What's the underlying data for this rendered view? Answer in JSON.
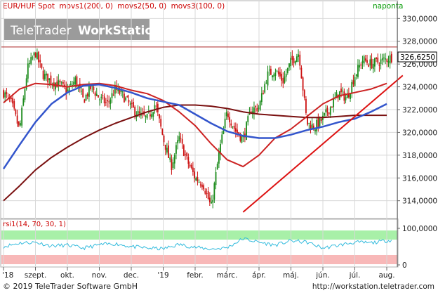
{
  "header": {
    "instrument": "EUR/HUF Spot",
    "indicator1": "movs1(200, 0)",
    "indicator2": "movs2(50, 0)",
    "indicator3": "movs3(100, 0)",
    "period": "naponta"
  },
  "watermark": {
    "brand": "TeleTrader",
    "product": "WorkStation"
  },
  "footer": {
    "copyright": "© 2019 TeleTrader Software GmbH",
    "url": "http://workstation.teletrader.com"
  },
  "colors": {
    "candle_up": "#1a8a1a",
    "candle_down": "#cc1111",
    "ma200": "#7a1010",
    "ma50": "#cc2222",
    "ma100": "#3355cc",
    "trendline": "#dd1111",
    "resistance": "#aa2222",
    "rsi_line": "#33bbdd",
    "rsi_over": "#a8f0a8",
    "rsi_under": "#f8b8b8",
    "header_text": "#cc0000",
    "period_text": "#009900"
  },
  "chart_data": [
    {
      "type": "candlestick",
      "title": "EUR/HUF Spot",
      "ylim": [
        312.5,
        331.5
      ],
      "y_ticks": [
        314,
        316,
        318,
        320,
        322,
        324,
        326,
        328,
        330
      ],
      "y_tick_labels": [
        "314,0000",
        "316,0000",
        "318,0000",
        "320,0000",
        "322,0000",
        "324,0000",
        "326,0000",
        "328,0000",
        "330,0000"
      ],
      "last_price": 326.625,
      "last_price_label": "326,6250",
      "resistance_level": 327.5,
      "x_tick_labels": [
        "'18",
        "szept.",
        "okt.",
        "nov.",
        "dec.",
        "'19",
        "febr.",
        "márc.",
        "ápr.",
        "máj.",
        "jún.",
        "júl.",
        "aug."
      ],
      "x_tick_month_index": [
        0,
        1,
        2,
        3,
        4,
        5,
        6,
        7,
        8,
        9,
        10,
        11,
        12
      ],
      "series": [
        {
          "name": "EUR/HUF Spot",
          "role": "close",
          "months": [
            0,
            0.25,
            0.5,
            0.75,
            1,
            1.25,
            1.5,
            1.75,
            2,
            2.25,
            2.5,
            2.75,
            3,
            3.25,
            3.5,
            3.75,
            4,
            4.25,
            4.5,
            4.75,
            5,
            5.25,
            5.5,
            5.75,
            6,
            6.25,
            6.5,
            6.75,
            7,
            7.25,
            7.5,
            7.75,
            8,
            8.25,
            8.5,
            8.75,
            9,
            9.25,
            9.5,
            9.75,
            10,
            10.25,
            10.5,
            10.75,
            11,
            11.25,
            11.5,
            11.75,
            12.15
          ],
          "values": [
            323.5,
            322.5,
            320.2,
            325.6,
            327.0,
            325.0,
            324.5,
            324.2,
            323.6,
            324.6,
            322.8,
            324.0,
            323.0,
            322.5,
            323.8,
            323.2,
            322.2,
            321.5,
            321.2,
            322.5,
            319.5,
            317.0,
            319.5,
            317.5,
            316.0,
            315.5,
            313.4,
            318.2,
            321.8,
            320.2,
            319.4,
            322.0,
            322.2,
            325.0,
            325.5,
            324.5,
            326.2,
            327.0,
            320.8,
            320.5,
            321.2,
            322.3,
            323.5,
            323.0,
            325.0,
            326.4,
            326.0,
            326.2,
            326.6
          ]
        },
        {
          "name": "movs1(200, 0)",
          "role": "ma",
          "months": [
            0,
            0.5,
            1,
            1.5,
            2,
            2.5,
            3,
            3.5,
            4,
            4.5,
            5,
            5.5,
            6,
            6.5,
            7,
            7.5,
            8,
            8.5,
            9,
            9.5,
            10,
            10.5,
            11,
            11.5,
            12
          ],
          "values": [
            314.0,
            315.3,
            316.7,
            317.8,
            318.7,
            319.5,
            320.2,
            320.8,
            321.3,
            321.8,
            322.2,
            322.4,
            322.4,
            322.3,
            322.1,
            321.8,
            321.6,
            321.5,
            321.4,
            321.3,
            321.3,
            321.4,
            321.5,
            321.5,
            321.5
          ]
        },
        {
          "name": "movs2(50, 0)",
          "role": "ma",
          "months": [
            0,
            0.5,
            1,
            1.5,
            2,
            2.5,
            3,
            3.5,
            4,
            4.5,
            5,
            5.5,
            6,
            6.5,
            7,
            7.5,
            8,
            8.5,
            9,
            9.5,
            10,
            10.5,
            11,
            11.5,
            12
          ],
          "values": [
            322.6,
            323.8,
            324.3,
            324.2,
            324.0,
            324.2,
            324.3,
            324.1,
            323.7,
            323.4,
            322.8,
            321.8,
            320.6,
            319.0,
            317.6,
            317.0,
            318.0,
            319.5,
            320.3,
            321.4,
            322.5,
            323.2,
            323.5,
            323.8,
            324.3
          ]
        },
        {
          "name": "movs3(100, 0)",
          "role": "ma",
          "months": [
            0,
            0.5,
            1,
            1.5,
            2,
            2.5,
            3,
            3.5,
            4,
            4.5,
            5,
            5.5,
            6,
            6.5,
            7,
            7.5,
            8,
            8.5,
            9,
            9.5,
            10,
            10.5,
            11,
            11.5,
            12
          ],
          "values": [
            316.8,
            318.9,
            320.9,
            322.5,
            323.5,
            324.1,
            324.2,
            323.9,
            323.5,
            323.0,
            322.7,
            322.4,
            321.6,
            320.8,
            320.1,
            319.7,
            319.5,
            319.5,
            319.8,
            320.2,
            320.5,
            320.9,
            321.2,
            321.8,
            322.5
          ]
        },
        {
          "name": "trendline",
          "role": "trend",
          "months": [
            7.5,
            12.5
          ],
          "values": [
            313.0,
            325.0
          ]
        }
      ]
    },
    {
      "type": "line",
      "title": "rsi1(14, 70, 30, 1)",
      "ylim": [
        0,
        100
      ],
      "y_ticks": [
        0,
        100
      ],
      "y_tick_labels": [
        "0",
        "100,0000"
      ],
      "overbought": 70,
      "oversold": 30,
      "series": [
        {
          "name": "rsi1(14, 70, 30, 1)",
          "months": [
            0,
            0.5,
            1,
            1.5,
            2,
            2.5,
            3,
            3.5,
            4,
            4.5,
            5,
            5.5,
            6,
            6.5,
            7,
            7.5,
            8,
            8.5,
            9,
            9.5,
            10,
            10.5,
            11,
            11.5,
            12.15
          ],
          "values": [
            50,
            60,
            62,
            52,
            54,
            46,
            55,
            58,
            50,
            46,
            44,
            56,
            48,
            43,
            47,
            72,
            62,
            54,
            66,
            62,
            46,
            54,
            62,
            60,
            68
          ]
        }
      ]
    }
  ]
}
